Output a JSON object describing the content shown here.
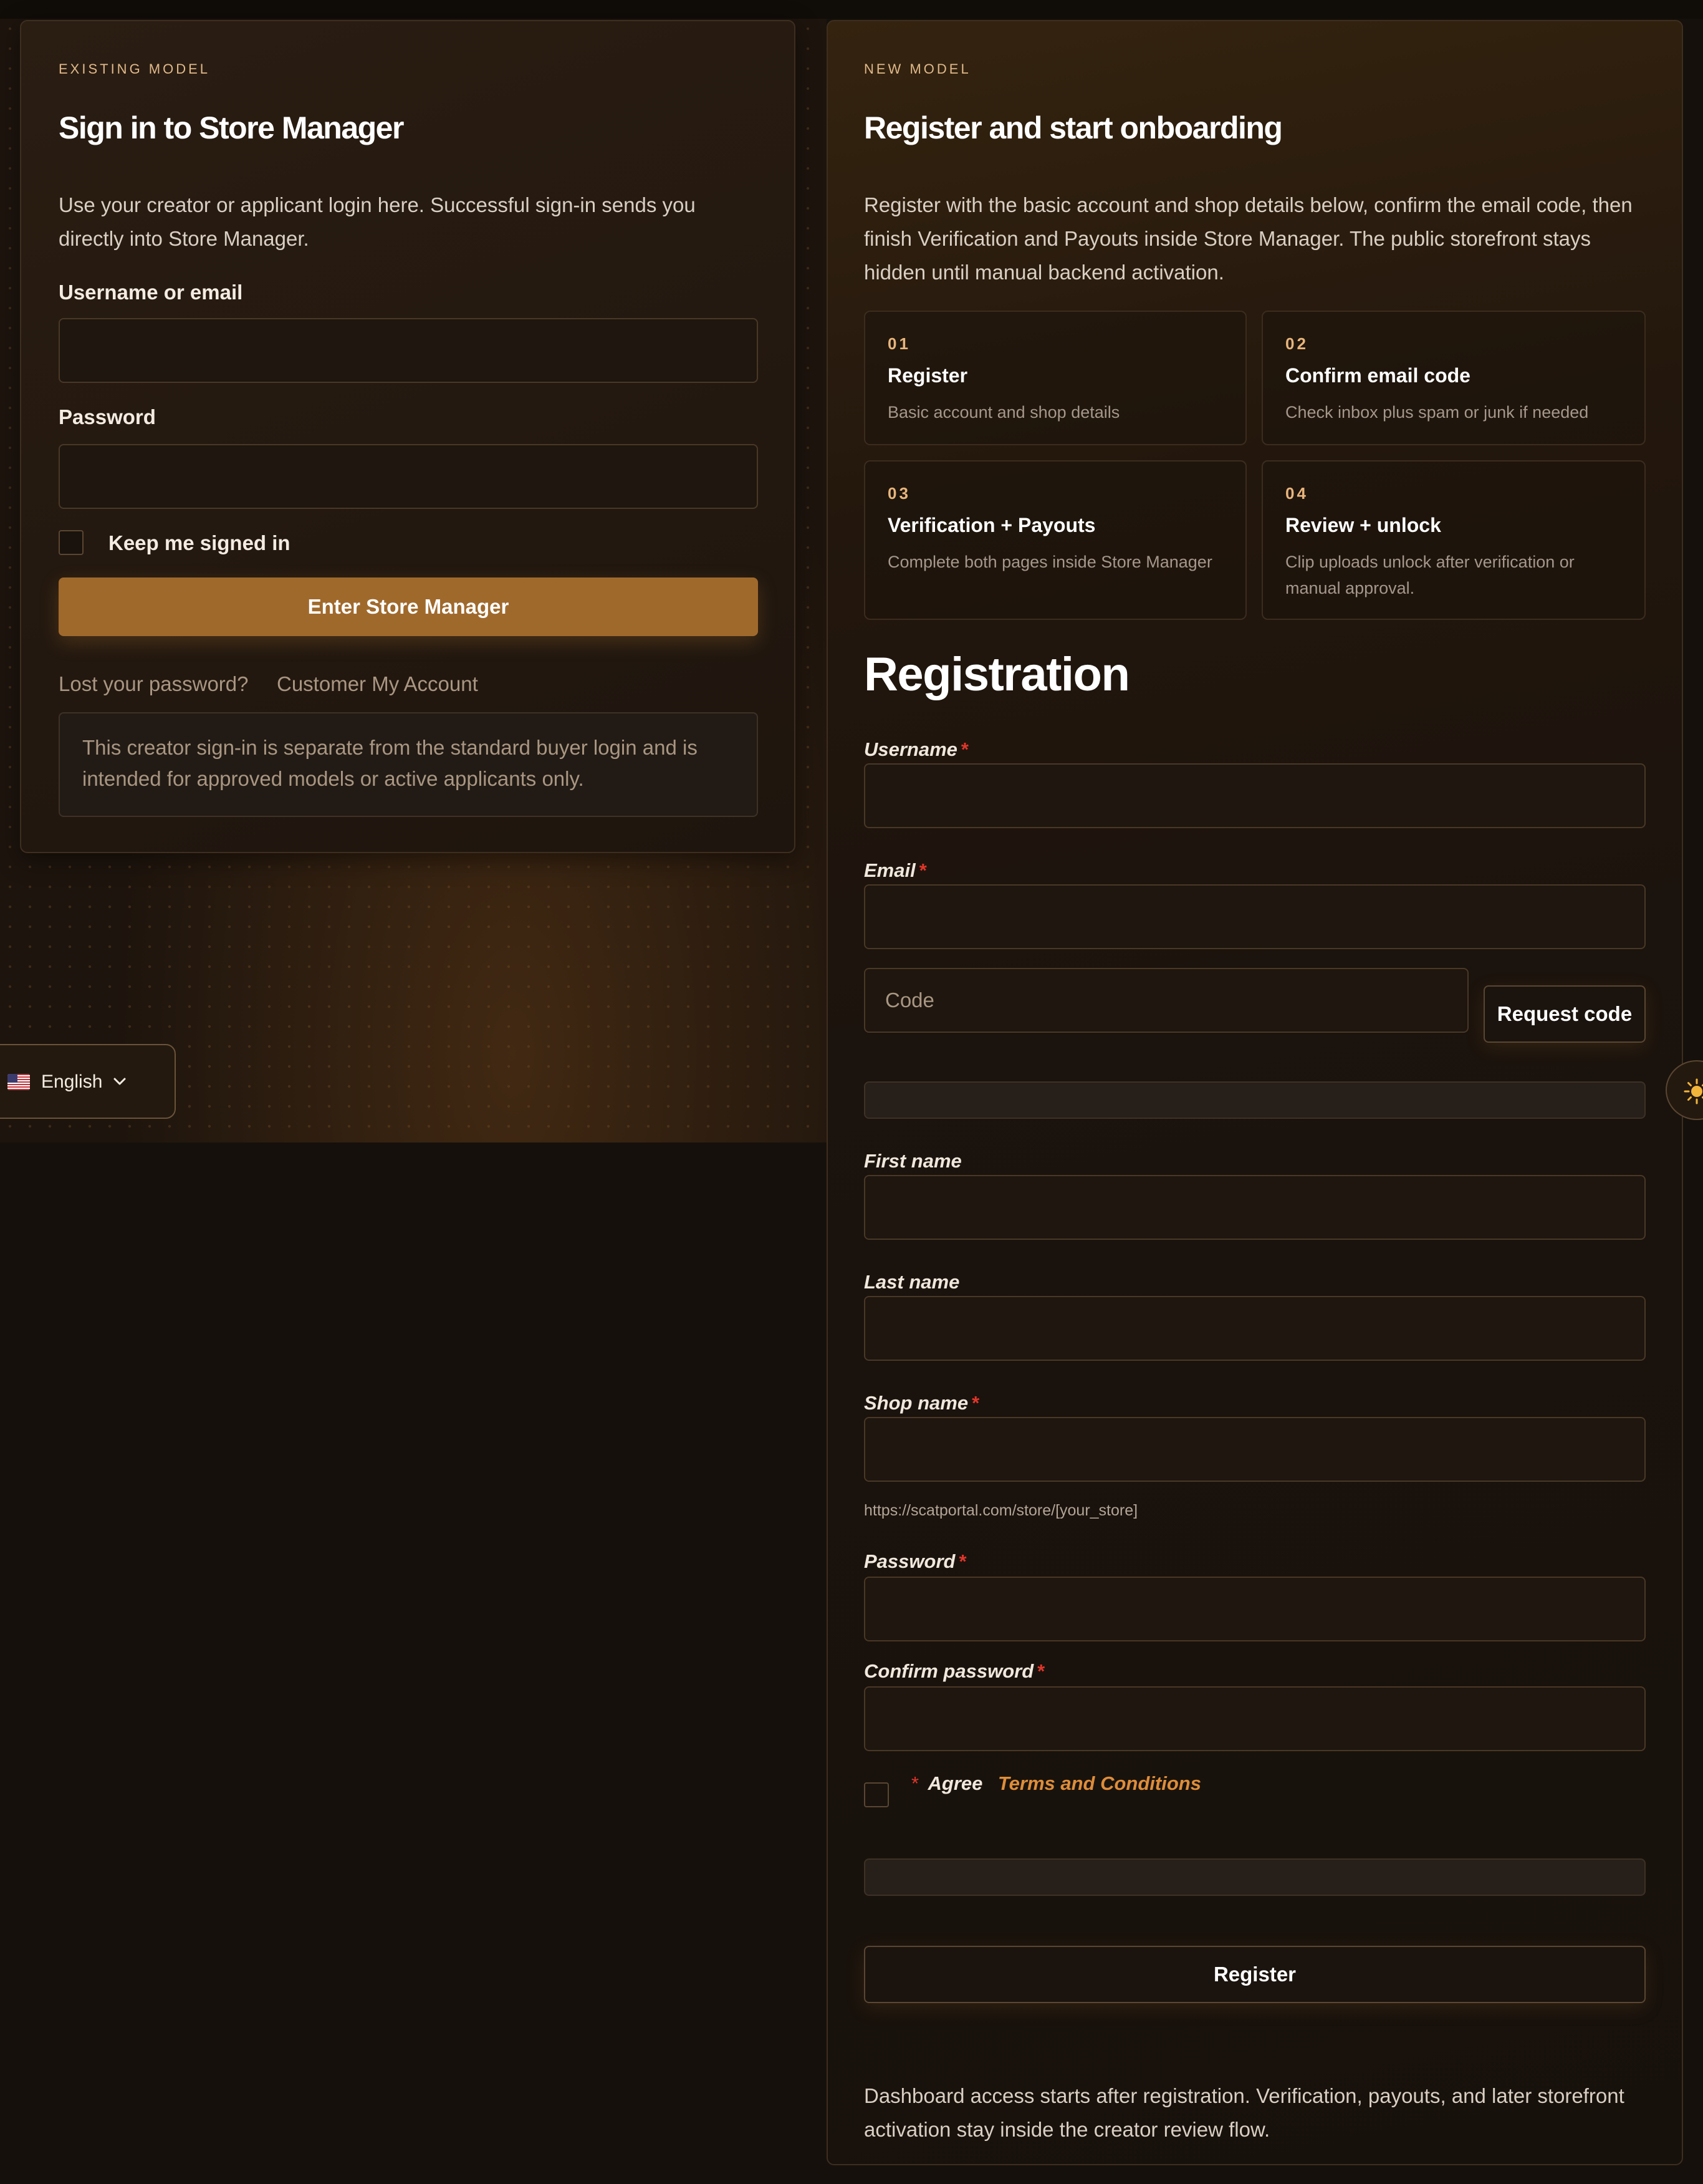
{
  "signin": {
    "eyebrow": "EXISTING MODEL",
    "title": "Sign in to Store Manager",
    "description": "Use your creator or applicant login here. Successful sign-in sends you directly into Store Manager.",
    "username_label": "Username or email",
    "username_value": "",
    "password_label": "Password",
    "password_value": "",
    "remember_label": "Keep me signed in",
    "submit_label": "Enter Store Manager",
    "lost_password_link": "Lost your password?",
    "customer_account_link": "Customer My Account",
    "notice": "This creator sign-in is separate from the standard buyer login and is intended for approved models or active applicants only."
  },
  "onboarding": {
    "eyebrow": "NEW MODEL",
    "title": "Register and start onboarding",
    "description": "Register with the basic account and shop details below, confirm the email code, then finish Verification and Payouts inside Store Manager. The public storefront stays hidden until manual backend activation.",
    "steps": [
      {
        "num": "01",
        "title": "Register",
        "desc": "Basic account and shop details"
      },
      {
        "num": "02",
        "title": "Confirm email code",
        "desc": "Check inbox plus spam or junk if needed"
      },
      {
        "num": "03",
        "title": "Verification + Payouts",
        "desc": "Complete both pages inside Store Manager"
      },
      {
        "num": "04",
        "title": "Review + unlock",
        "desc": "Clip uploads unlock after verification or manual approval."
      }
    ]
  },
  "registration": {
    "heading": "Registration",
    "required_mark": "*",
    "username_label": "Username",
    "email_label": "Email",
    "code_placeholder": "Code",
    "request_code_label": "Request code",
    "first_name_label": "First name",
    "last_name_label": "Last name",
    "shop_name_label": "Shop name",
    "shop_url_hint": "https://scatportal.com/store/[your_store]",
    "password_label": "Password",
    "confirm_password_label": "Confirm password",
    "agree_label": "Agree",
    "terms_link": "Terms and Conditions",
    "register_label": "Register",
    "footer_note": "Dashboard access starts after registration. Verification, payouts, and later storefront activation stay inside the creator review flow."
  },
  "language": {
    "label": "English",
    "icon": "us-flag-icon"
  },
  "theme_toggle": {
    "icon": "sun-icon"
  },
  "colors": {
    "accent": "#a0692c",
    "link": "#de8d3a",
    "required": "#e0362a",
    "background": "#15100b"
  }
}
